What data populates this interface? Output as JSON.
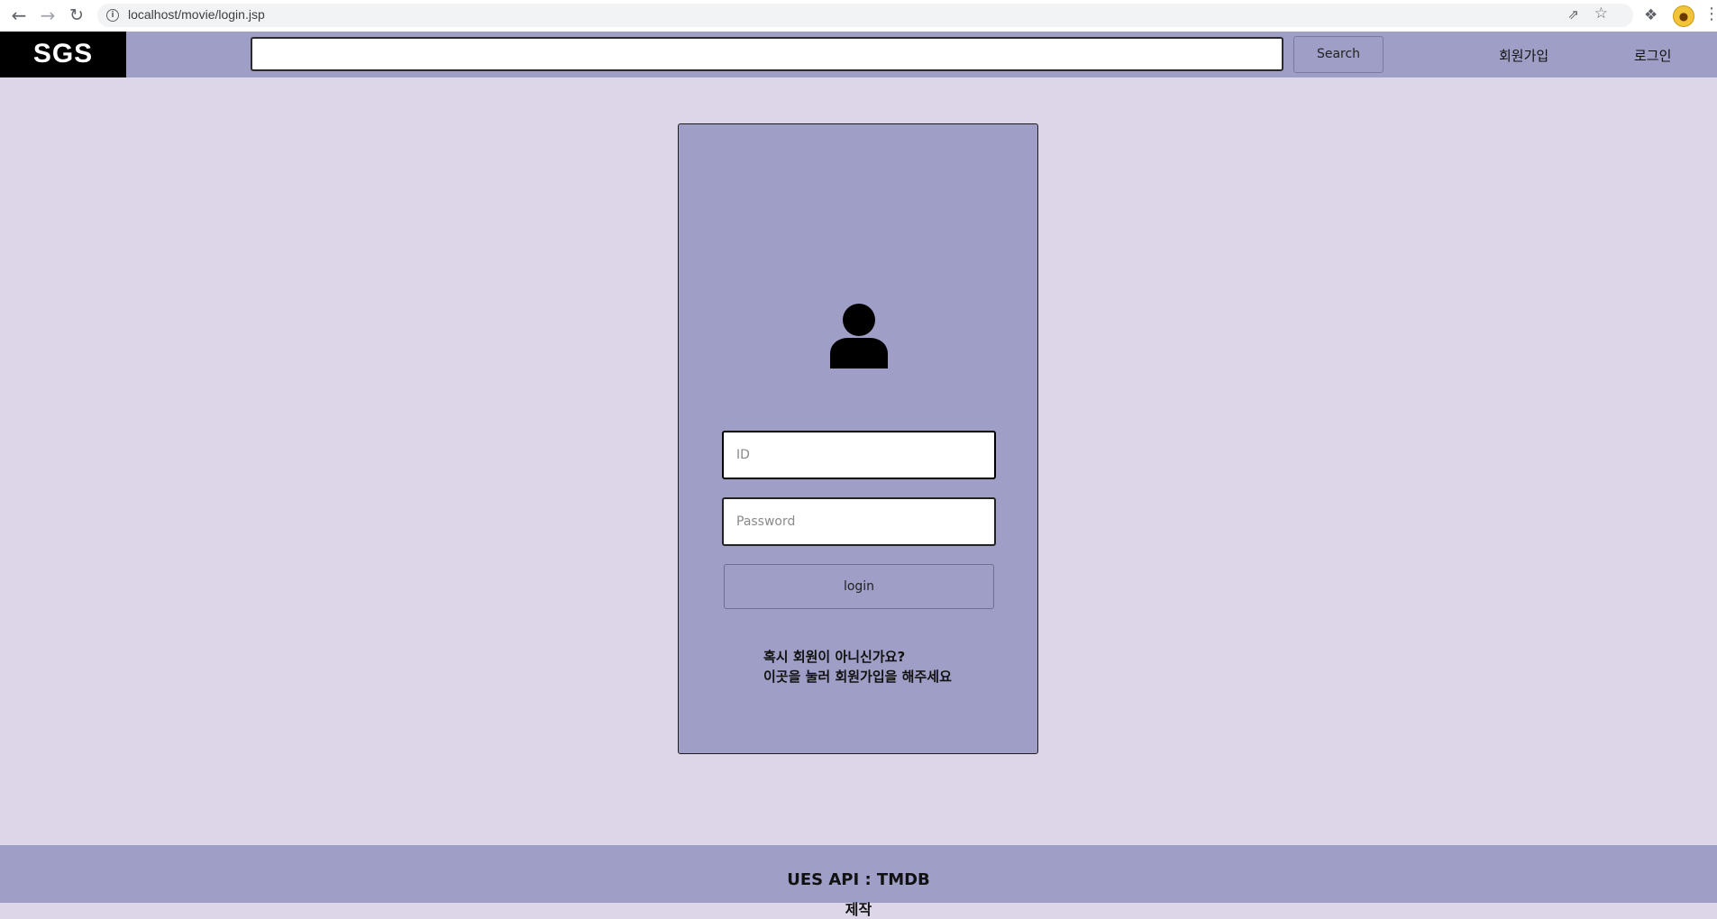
{
  "browser": {
    "url": "localhost/movie/login.jsp"
  },
  "header": {
    "logo": "SGS",
    "search_placeholder": "",
    "search_button": "Search",
    "signup_link": "회원가입",
    "login_link": "로그인"
  },
  "login": {
    "id_placeholder": "ID",
    "password_placeholder": "Password",
    "login_button": "login",
    "join_prompt_line1": "혹시 회원이 아니신가요?",
    "join_prompt_line2": "이곳을 눌러 회원가입을 해주세요"
  },
  "footer": {
    "api_credit": "UES API : TMDB",
    "second_line": "제작"
  },
  "colors": {
    "page_background": "#ddd5e8",
    "accent": "#9e9ec6",
    "logo_background": "#000000"
  }
}
